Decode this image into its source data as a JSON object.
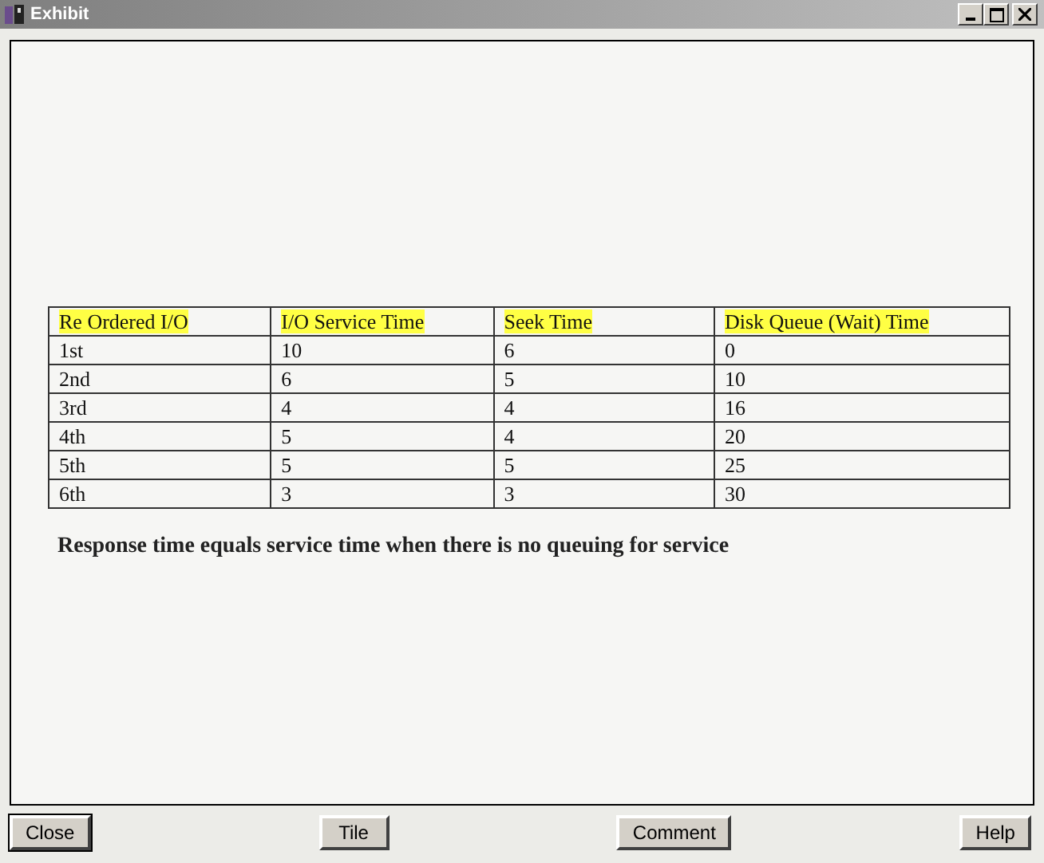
{
  "window": {
    "title": "Exhibit"
  },
  "table": {
    "columns": [
      "Re Ordered I/O",
      "I/O Service Time",
      "Seek Time",
      "Disk Queue (Wait) Time"
    ],
    "rows": [
      [
        "1st",
        "10",
        "6",
        "0"
      ],
      [
        "2nd",
        "6",
        "5",
        "10"
      ],
      [
        "3rd",
        "4",
        "4",
        "16"
      ],
      [
        "4th",
        "5",
        "4",
        "20"
      ],
      [
        "5th",
        "5",
        "5",
        "25"
      ],
      [
        "6th",
        "3",
        "3",
        "30"
      ]
    ]
  },
  "note": "Response time equals service time when there is no queuing for service",
  "buttons": [
    {
      "label": "Close",
      "default": true
    },
    {
      "label": "Tile",
      "default": false
    },
    {
      "label": "Comment",
      "default": false
    },
    {
      "label": "Help",
      "default": false
    }
  ]
}
